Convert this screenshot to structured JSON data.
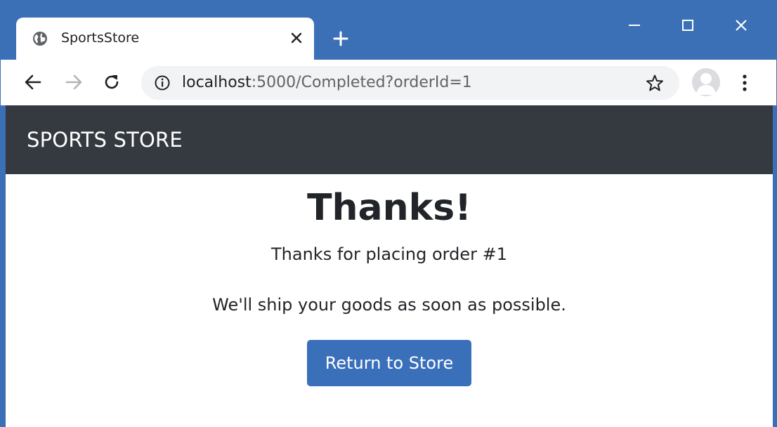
{
  "browser": {
    "tab": {
      "title": "SportsStore",
      "favicon": "globe-icon"
    },
    "address_bar": {
      "host": "localhost",
      "rest": ":5000/Completed?orderId=1"
    },
    "colors": {
      "frame": "#3b6fb6",
      "omnibox": "#f1f3f4"
    }
  },
  "page": {
    "navbar": {
      "brand": "SPORTS STORE",
      "background": "#343a40"
    },
    "heading": "Thanks!",
    "message": "Thanks for placing order #1",
    "shipping_note": "We'll ship your goods as soon as possible.",
    "return_button": {
      "label": "Return to Store",
      "color": "#3a6fba"
    }
  }
}
